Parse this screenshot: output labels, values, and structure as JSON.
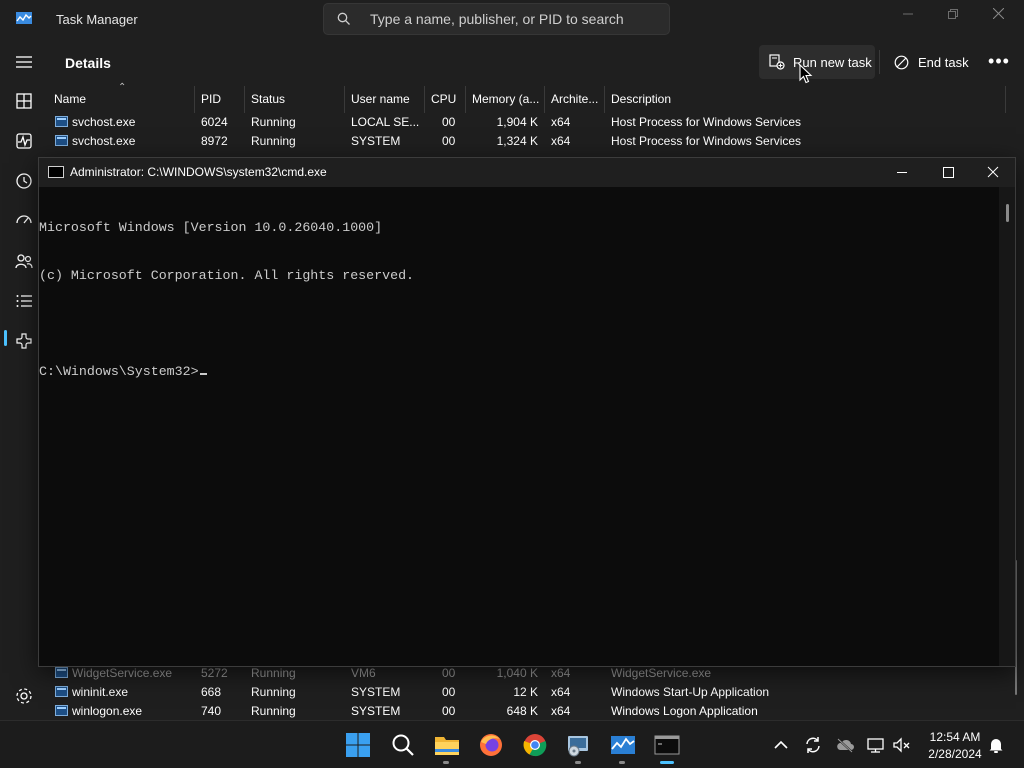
{
  "task_manager": {
    "title": "Task Manager",
    "search_placeholder": "Type a name, publisher, or PID to search",
    "page_title": "Details",
    "run_new_task_label": "Run new task",
    "end_task_label": "End task",
    "more_label": "•••",
    "columns": [
      "Name",
      "PID",
      "Status",
      "User name",
      "CPU",
      "Memory (a...",
      "Archite...",
      "Description"
    ],
    "rows_top": [
      {
        "name": "svchost.exe",
        "pid": "6024",
        "status": "Running",
        "user": "LOCAL SE...",
        "cpu": "00",
        "mem": "1,904 K",
        "arch": "x64",
        "desc": "Host Process for Windows Services"
      },
      {
        "name": "svchost.exe",
        "pid": "8972",
        "status": "Running",
        "user": "SYSTEM",
        "cpu": "00",
        "mem": "1,324 K",
        "arch": "x64",
        "desc": "Host Process for Windows Services"
      }
    ],
    "rows_bottom": [
      {
        "name": "WidgetService.exe",
        "pid": "5272",
        "status": "Running",
        "user": "VM6",
        "cpu": "00",
        "mem": "1,040 K",
        "arch": "x64",
        "desc": "WidgetService.exe"
      },
      {
        "name": "wininit.exe",
        "pid": "668",
        "status": "Running",
        "user": "SYSTEM",
        "cpu": "00",
        "mem": "12 K",
        "arch": "x64",
        "desc": "Windows Start-Up Application"
      },
      {
        "name": "winlogon.exe",
        "pid": "740",
        "status": "Running",
        "user": "SYSTEM",
        "cpu": "00",
        "mem": "648 K",
        "arch": "x64",
        "desc": "Windows Logon Application"
      }
    ]
  },
  "cmd": {
    "title": "Administrator: C:\\WINDOWS\\system32\\cmd.exe",
    "lines": [
      "Microsoft Windows [Version 10.0.26040.1000]",
      "(c) Microsoft Corporation. All rights reserved.",
      "",
      "C:\\Windows\\System32>"
    ]
  },
  "taskbar": {
    "apps": [
      "start-icon",
      "search-icon",
      "file-explorer-icon",
      "firefox-icon",
      "chrome-icon",
      "disk-utility-icon",
      "task-manager-icon",
      "terminal-icon"
    ],
    "clock_time": "12:54 AM",
    "clock_date": "2/28/2024"
  },
  "colors": {
    "accent": "#4cc2ff",
    "window_bg": "#1f1f1f",
    "console_bg": "#0c0c0c",
    "console_text": "#cccccc"
  }
}
